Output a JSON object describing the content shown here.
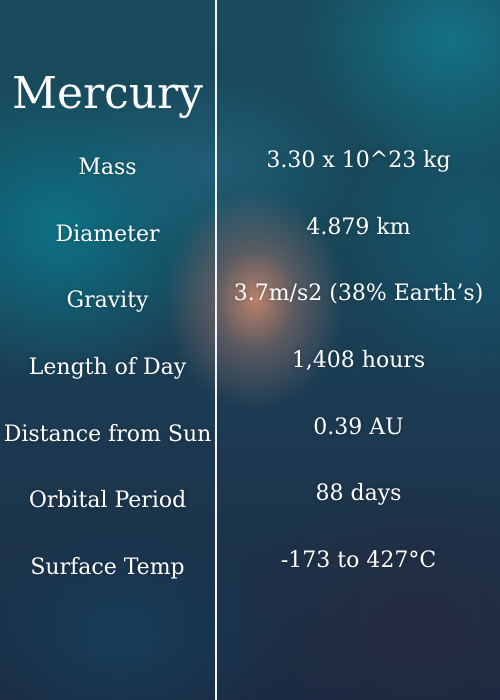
{
  "planet": {
    "name": "Mercury"
  },
  "facts": [
    {
      "label": "Mass",
      "value": "3.30 x 10^23 kg"
    },
    {
      "label": "Diameter",
      "value": "4.879 km"
    },
    {
      "label": "Gravity",
      "value": "3.7m/s2 (38% Earth’s)"
    },
    {
      "label": "Length of Day",
      "value": "1,408 hours"
    },
    {
      "label": "Distance from Sun",
      "value": "0.39 AU"
    },
    {
      "label": "Orbital Period",
      "value": "88 days"
    },
    {
      "label": "Surface Temp",
      "value": "-173 to 427°C"
    }
  ]
}
